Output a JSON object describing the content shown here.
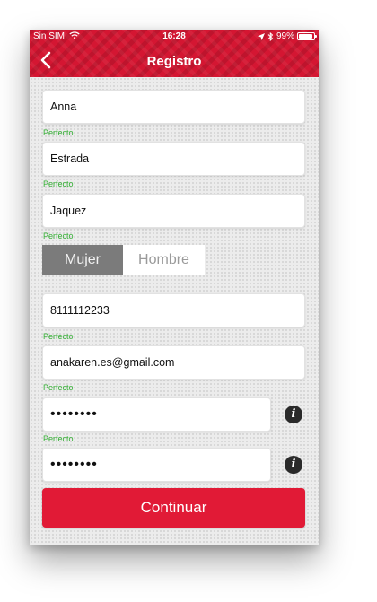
{
  "status_bar": {
    "carrier": "Sin SIM",
    "time": "16:28",
    "battery": "99%",
    "battery_level": 0.99
  },
  "header": {
    "title": "Registro",
    "back_icon": "chevron-left-icon"
  },
  "form": {
    "first_name": "Anna",
    "first_name_hint": "Perfecto",
    "last_name": "Estrada",
    "last_name_hint": "Perfecto",
    "second_last_name": "Jaquez",
    "second_last_name_hint": "Perfecto",
    "gender_female": "Mujer",
    "gender_male": "Hombre",
    "gender_selected": "Mujer",
    "phone": "8111112233",
    "phone_hint": "Perfecto",
    "email": "anakaren.es@gmail.com",
    "email_hint": "Perfecto",
    "password": "••••••••",
    "password_hint": "Perfecto",
    "password_confirm": "••••••••",
    "info_icon_label": "i"
  },
  "actions": {
    "continue_label": "Continuar"
  },
  "colors": {
    "brand_red": "#d41632",
    "button_red": "#e11a36",
    "success_green": "#35b035",
    "toggle_selected": "#7b7b7b"
  }
}
